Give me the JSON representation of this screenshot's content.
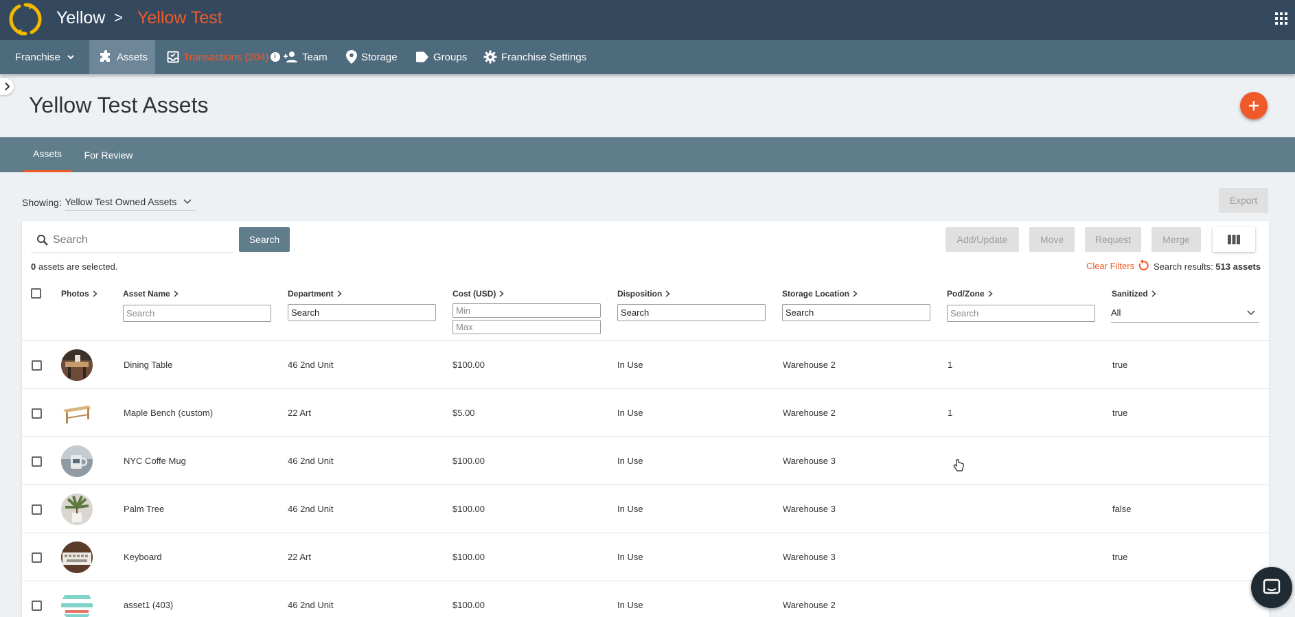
{
  "header": {
    "breadcrumb_root": "Yellow",
    "breadcrumb_separator": ">",
    "breadcrumb_current": "Yellow Test",
    "logo_icon": "refresh-logo-icon",
    "apps_icon": "grid-apps-icon",
    "colors": {
      "topbar": "#34495e",
      "accent": "#f05a28",
      "logo": "#f5b800"
    }
  },
  "nav": {
    "items": [
      {
        "label": "Franchise",
        "icon": "chevron-down-icon"
      },
      {
        "label": "Assets",
        "icon": "puzzle-icon",
        "active": true
      },
      {
        "label": "Transactions (204)",
        "icon": "inbox-icon",
        "badge": "i"
      },
      {
        "label": "Team",
        "icon": "add-person-icon"
      },
      {
        "label": "Storage",
        "icon": "location-pin-icon"
      },
      {
        "label": "Groups",
        "icon": "tag-icon"
      },
      {
        "label": "Franchise Settings",
        "icon": "gear-icon"
      }
    ]
  },
  "page": {
    "title": "Yellow Test Assets",
    "add_icon": "plus-icon"
  },
  "subtabs": [
    {
      "label": "Assets",
      "active": true
    },
    {
      "label": "For Review"
    }
  ],
  "toolbar": {
    "showing_label": "Showing:",
    "showing_value": "Yellow Test Owned Assets",
    "export_label": "Export",
    "search_placeholder": "Search",
    "search_button": "Search",
    "add_update": "Add/Update",
    "move": "Move",
    "request": "Request",
    "merge": "Merge",
    "columns_icon": "view-columns-icon"
  },
  "status": {
    "selected_count": "0",
    "selected_text": " assets are selected.",
    "clear_filters": "Clear Filters",
    "results_label": "Search results: ",
    "results_value": "513 assets"
  },
  "table": {
    "columns": [
      "Photos",
      "Asset Name",
      "Department",
      "Cost (USD)",
      "Disposition",
      "Storage Location",
      "Pod/Zone",
      "Sanitized"
    ],
    "filters": {
      "asset_name": "Search",
      "department": "Search",
      "cost_min": "Min",
      "cost_max": "Max",
      "disposition": "Search",
      "storage_location": "Search",
      "pod_zone": "Search",
      "sanitized": "All"
    },
    "rows": [
      {
        "name": "Dining Table",
        "department": "46 2nd Unit",
        "cost": "$100.00",
        "disposition": "In Use",
        "location": "Warehouse 2",
        "pod": "1",
        "sanitized": "true"
      },
      {
        "name": "Maple Bench (custom)",
        "department": "22 Art",
        "cost": "$5.00",
        "disposition": "In Use",
        "location": "Warehouse 2",
        "pod": "1",
        "sanitized": "true"
      },
      {
        "name": "NYC Coffe Mug",
        "department": "46 2nd Unit",
        "cost": "$100.00",
        "disposition": "In Use",
        "location": "Warehouse 3",
        "pod": "",
        "sanitized": ""
      },
      {
        "name": "Palm Tree",
        "department": "46 2nd Unit",
        "cost": "$100.00",
        "disposition": "In Use",
        "location": "Warehouse 3",
        "pod": "",
        "sanitized": "false"
      },
      {
        "name": "Keyboard",
        "department": "22 Art",
        "cost": "$100.00",
        "disposition": "In Use",
        "location": "Warehouse 3",
        "pod": "",
        "sanitized": "true"
      },
      {
        "name": "asset1 (403)",
        "department": "46 2nd Unit",
        "cost": "$100.00",
        "disposition": "In Use",
        "location": "Warehouse 2",
        "pod": "",
        "sanitized": ""
      }
    ]
  },
  "chat": {
    "icon": "chat-bubble-icon"
  }
}
